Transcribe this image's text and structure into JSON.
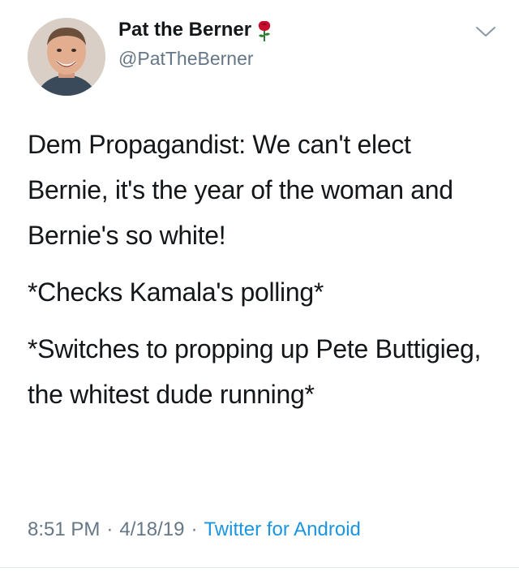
{
  "tweet": {
    "display_name": "Pat the Berner",
    "handle": "@PatTheBerner",
    "paragraphs": [
      "Dem Propagandist: We can't elect Bernie, it's the year of the woman and Bernie's so white!",
      "*Checks Kamala's polling*",
      "*Switches to propping up Pete Buttigieg, the whitest dude running*"
    ],
    "time": "8:51 PM",
    "separator": "·",
    "date": "4/18/19",
    "source": "Twitter for Android"
  },
  "icons": {
    "name_badge": "rose-icon",
    "menu": "chevron-down-icon"
  },
  "colors": {
    "text": "#14171a",
    "secondary": "#657786",
    "link": "#1b95e0",
    "rose": "#c8102e"
  }
}
